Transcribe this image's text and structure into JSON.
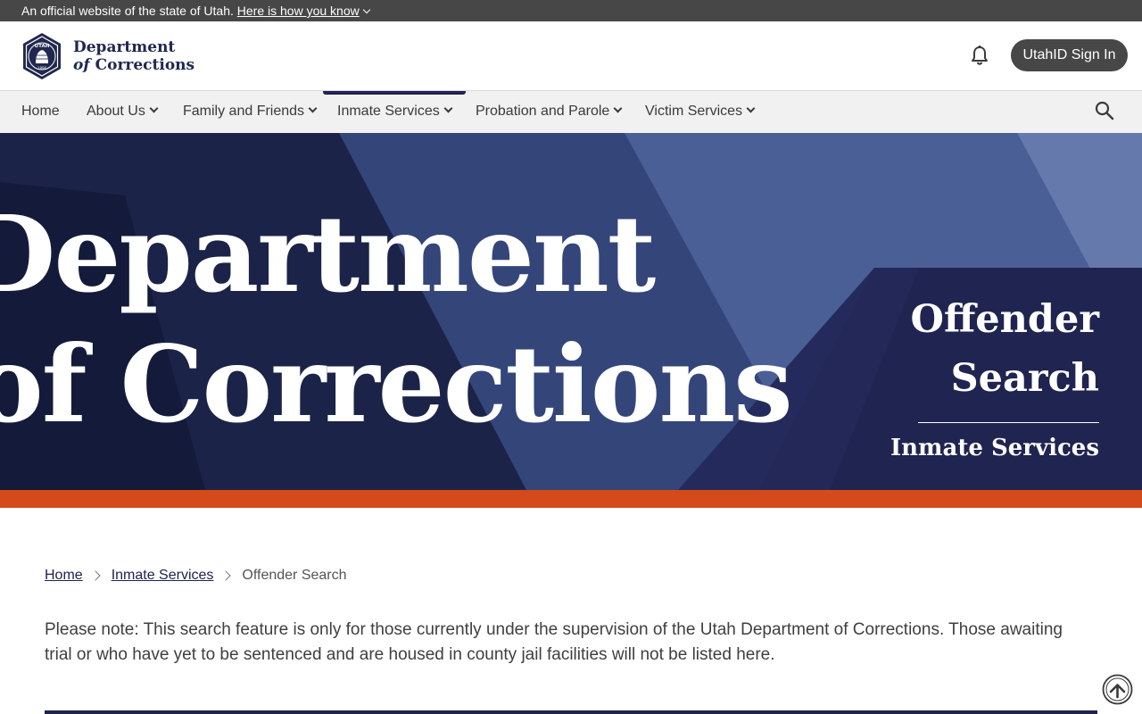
{
  "banner": {
    "text": "An official website of the state of Utah.",
    "link": "Here is how you know"
  },
  "header": {
    "logo": {
      "line1": "Department",
      "line2_italic": "of",
      "line2_rest": "Corrections",
      "seal_text_top": "UTAH",
      "seal_text_bottom": "1896"
    },
    "notifications_icon": "bell-icon",
    "signin_label": "UtahID Sign In"
  },
  "nav": {
    "items": [
      {
        "label": "Home",
        "dropdown": false
      },
      {
        "label": "About Us",
        "dropdown": true
      },
      {
        "label": "Family and Friends",
        "dropdown": true
      },
      {
        "label": "Inmate Services",
        "dropdown": true,
        "active": true
      },
      {
        "label": "Probation and Parole",
        "dropdown": true
      },
      {
        "label": "Victim Services",
        "dropdown": true
      }
    ],
    "search_icon": "search-icon"
  },
  "hero": {
    "background_words": [
      "Department",
      "of Corrections"
    ],
    "title_line1": "Offender",
    "title_line2": "Search",
    "subtitle": "Inmate Services",
    "accent_color": "#d54a1a",
    "panel_color": "#20234f"
  },
  "breadcrumb": {
    "items": [
      "Home",
      "Inmate Services"
    ],
    "current": "Offender Search"
  },
  "content": {
    "note": "Please note: This search feature is only for those currently under the supervision of the Utah Department of Corrections. Those awaiting trial or who have yet to be sentenced and are housed in county jail facilities will not be listed here."
  },
  "back_to_top_icon": "arrow-up-circle-icon"
}
